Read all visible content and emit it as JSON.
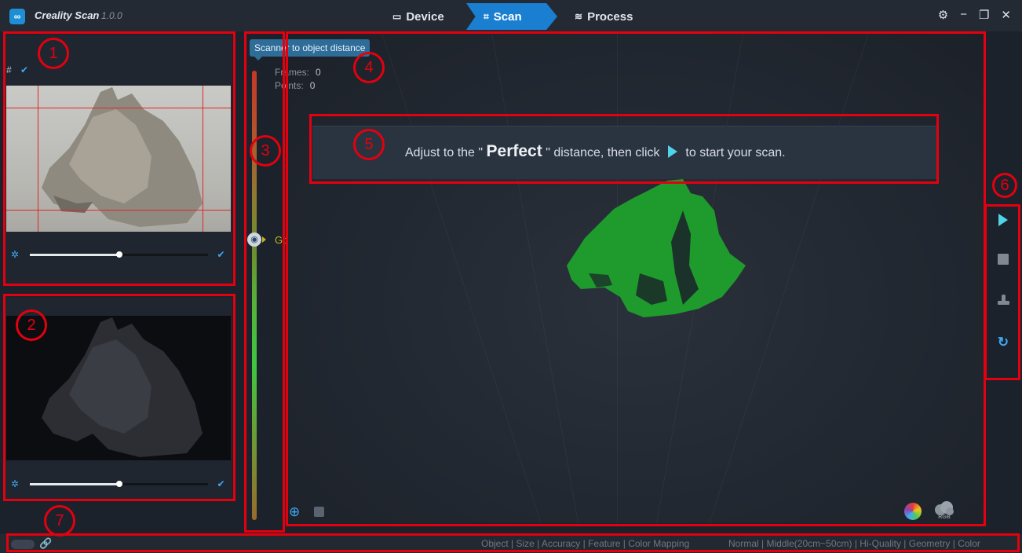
{
  "app": {
    "name": "Creality Scan",
    "version": "1.0.0"
  },
  "steps": [
    {
      "label": "Device",
      "icon": "device-icon"
    },
    {
      "label": "Scan",
      "icon": "scan-icon"
    },
    {
      "label": "Process",
      "icon": "layers-icon"
    }
  ],
  "window_controls": [
    "settings-icon",
    "minimize-icon",
    "restore-icon",
    "close-icon"
  ],
  "camera1": {
    "grid_label": "#",
    "grid_enabled": true,
    "brightness_fraction": 0.5,
    "auto_checked": true
  },
  "camera2": {
    "brightness_fraction": 0.5,
    "auto_checked": true
  },
  "distance_gauge": {
    "tooltip": "Scanner to object distance",
    "status": "Good",
    "status_color": "#c6b21f"
  },
  "stats": {
    "frames_label": "Frames:",
    "frames_value": "0",
    "points_label": "Points:",
    "points_value": "0"
  },
  "banner": {
    "before": "Adjust to the \"",
    "highlight": "Perfect",
    "after_word": "\" distance, then click",
    "tail": "to start your scan."
  },
  "right_toolbar": [
    "play-icon",
    "stop-icon",
    "stamp-icon",
    "reset-icon"
  ],
  "viewport_tools": {
    "left": [
      "add-point-icon",
      "square-toggle"
    ],
    "right": [
      "color-wheel-icon",
      "rgb-cloud-icon"
    ],
    "rgb_label": "RGB"
  },
  "status_bar": {
    "object_settings": "Object | Size | Accuracy | Feature | Color Mapping",
    "mode_settings": "Normal | Middle(20cm~50cm) | Hi-Quality | Geometry | Color"
  },
  "annotations": [
    "1",
    "2",
    "3",
    "4",
    "5",
    "6",
    "7"
  ],
  "colors": {
    "accent": "#1a7fd0",
    "model_green": "#1f9a2c",
    "annotation_red": "#e3000f",
    "play": "#4fd3e8"
  }
}
